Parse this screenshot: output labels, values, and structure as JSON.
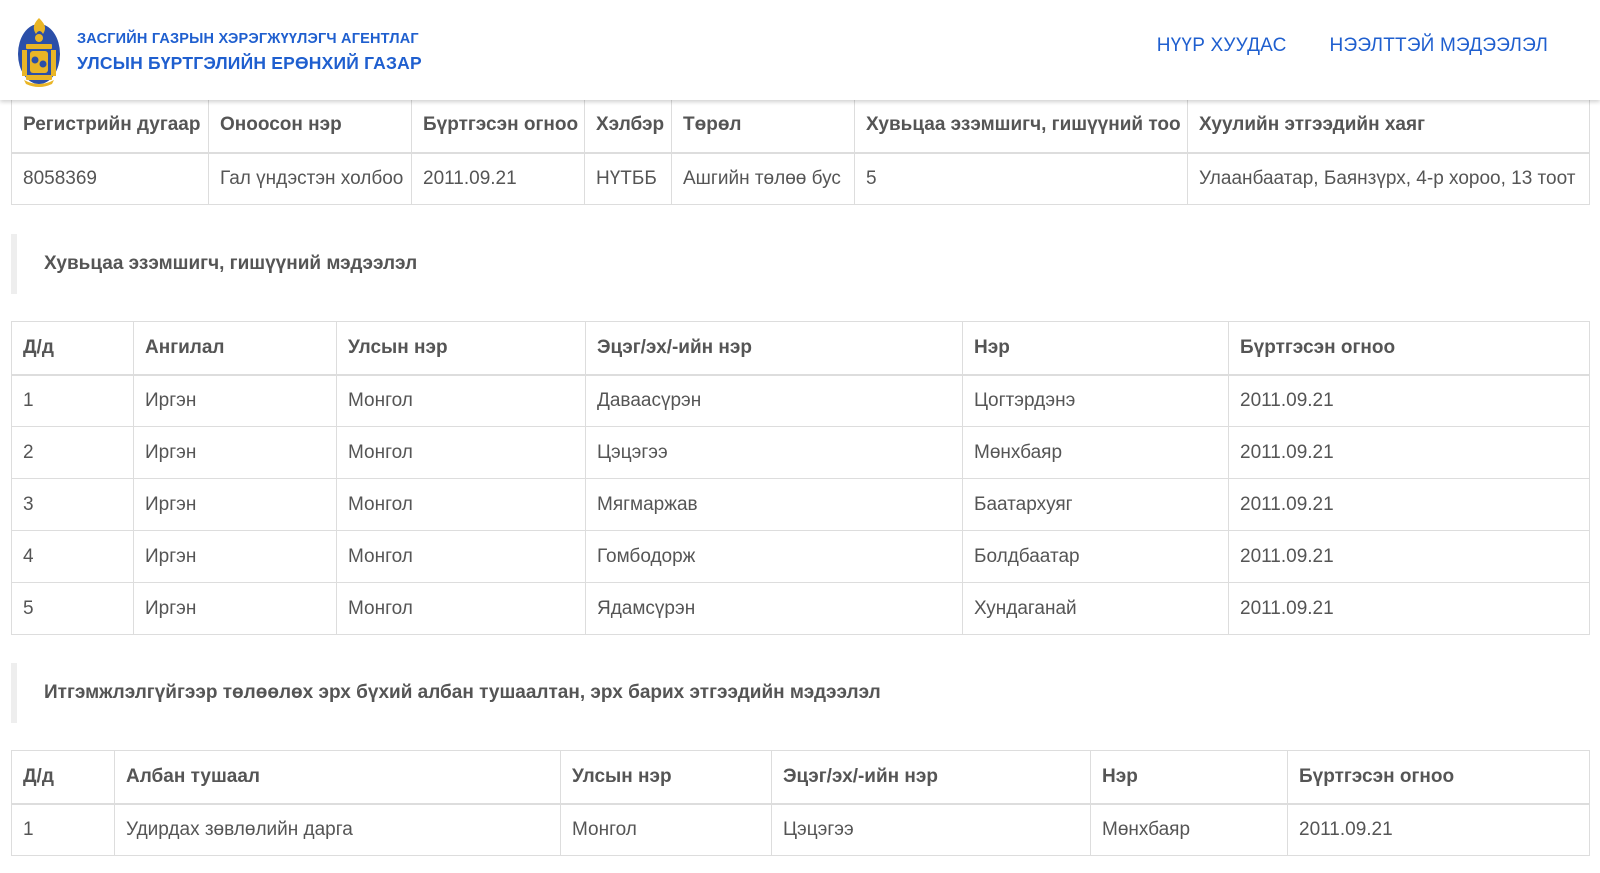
{
  "header": {
    "agency_line1": "ЗАСГИЙН ГАЗРЫН ХЭРЭГЖҮҮЛЭГЧ АГЕНТЛАГ",
    "agency_line2": "УЛСЫН БҮРТГЭЛИЙН ЕРӨНХИЙ ГАЗАР",
    "nav": [
      "НҮҮР ХУУДАС",
      "НЭЭЛТТЭЙ МЭДЭЭЛЭЛ"
    ],
    "logo_icon": "soyombo-emblem-icon"
  },
  "org_table": {
    "headers": [
      "Регистрийн дугаар",
      "Оноосон нэр",
      "Бүртгэсэн огноо",
      "Хэлбэр",
      "Төрөл",
      "Хувьцаа эзэмшигч, гишүүний тоо",
      "Хуулийн этгээдийн хаяг"
    ],
    "row": [
      "8058369",
      "Гал үндэстэн холбоо",
      "2011.09.21",
      "НҮТББ",
      "Ашгийн төлөө бус",
      "5",
      "Улаанбаатар, Баянзүрх, 4-р хороо, 13 тоот"
    ]
  },
  "members_section": {
    "title": "Хувьцаа эзэмшигч, гишүүний мэдээлэл",
    "headers": [
      "Д/д",
      "Ангилал",
      "Улсын нэр",
      "Эцэг/эх/-ийн нэр",
      "Нэр",
      "Бүртгэсэн огноо"
    ],
    "rows": [
      [
        "1",
        "Иргэн",
        "Монгол",
        "Даваасүрэн",
        "Цогтэрдэнэ",
        "2011.09.21"
      ],
      [
        "2",
        "Иргэн",
        "Монгол",
        "Цэцэгээ",
        "Мөнхбаяр",
        "2011.09.21"
      ],
      [
        "3",
        "Иргэн",
        "Монгол",
        "Мягмаржав",
        "Баатархуяг",
        "2011.09.21"
      ],
      [
        "4",
        "Иргэн",
        "Монгол",
        "Гомбодорж",
        "Болдбаатар",
        "2011.09.21"
      ],
      [
        "5",
        "Иргэн",
        "Монгол",
        "Ядамсүрэн",
        "Хундаганай",
        "2011.09.21"
      ]
    ]
  },
  "officials_section": {
    "title": "Итгэмжлэлгүйгээр төлөөлөх эрх бүхий албан тушаалтан, эрх барих этгээдийн мэдээлэл",
    "headers": [
      "Д/д",
      "Албан тушаал",
      "Улсын нэр",
      "Эцэг/эх/-ийн нэр",
      "Нэр",
      "Бүртгэсэн огноо"
    ],
    "rows": [
      [
        "1",
        "Удирдах зөвлөлийн дарга",
        "Монгол",
        "Цэцэгээ",
        "Мөнхбаяр",
        "2011.09.21"
      ]
    ]
  },
  "colors": {
    "brand_blue": "#1f5fcf",
    "logo_gold": "#e9b526",
    "logo_blue": "#2b4fa8",
    "text": "#555555",
    "border": "#dddddd"
  }
}
